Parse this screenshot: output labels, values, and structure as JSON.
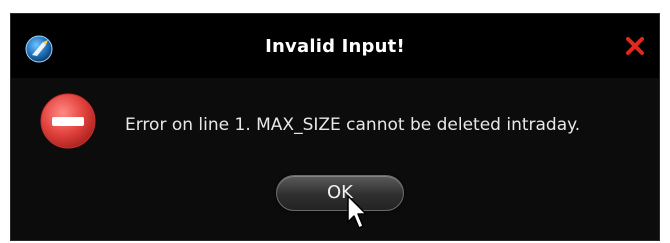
{
  "window": {
    "title": "Invalid Input!",
    "close_icon": "close-icon",
    "app_icon": "app-logo-icon"
  },
  "dialog": {
    "icon": "error-stop-icon",
    "message": "Error on line 1. MAX_SIZE cannot be deleted intraday.",
    "ok_label": "OK"
  },
  "colors": {
    "background": "#0c0c0c",
    "title_text": "#ffffff",
    "close_icon": "#e0291b",
    "error_icon": "#d93a37",
    "message_text": "#e8e8e8"
  }
}
